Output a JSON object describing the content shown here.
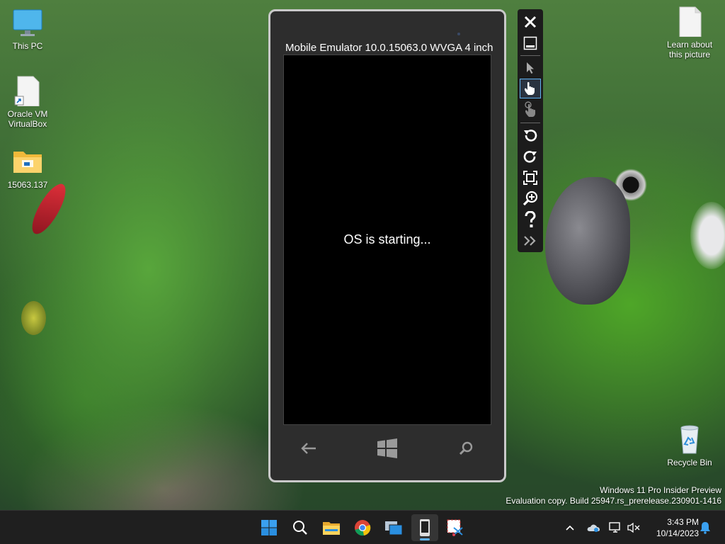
{
  "desktop": {
    "icons": [
      {
        "name": "This PC",
        "icon": "monitor-icon"
      },
      {
        "name": "Oracle VM\nVirtualBox",
        "icon": "shortcut-file-icon"
      },
      {
        "name": "15063.137",
        "icon": "folder-icon"
      },
      {
        "name": "Learn about\nthis picture",
        "icon": "file-icon"
      },
      {
        "name": "Recycle Bin",
        "icon": "recycle-bin-icon"
      }
    ]
  },
  "emulator": {
    "title": "Mobile Emulator 10.0.15063.0 WVGA 4 inch",
    "status": "OS is starting...",
    "nav": [
      "back-icon",
      "windows-start-icon",
      "search-icon"
    ]
  },
  "toolbar": {
    "buttons": [
      "close-icon",
      "minimize-icon",
      "pointer-icon",
      "single-touch-icon",
      "multi-touch-icon",
      "rotate-left-icon",
      "rotate-right-icon",
      "fit-to-screen-icon",
      "zoom-icon",
      "help-icon",
      "expand-tools-icon"
    ]
  },
  "watermark": {
    "line1": "Windows 11 Pro Insider Preview",
    "line2": "Evaluation copy. Build 25947.rs_prerelease.230901-1416"
  },
  "taskbar": {
    "apps": [
      "windows-start-icon",
      "search-icon",
      "file-explorer-icon",
      "chrome-icon",
      "task-view-icon",
      "emulator-app-icon",
      "snipping-tool-icon"
    ],
    "active_app": "emulator-app-icon",
    "tray": [
      "chevron-up-icon",
      "onedrive-icon",
      "network-icon",
      "volume-muted-icon",
      "notification-bell-icon"
    ],
    "time": "3:43 PM",
    "date": "10/14/2023"
  },
  "colors": {
    "accent": "#5fb2f2",
    "emulator_frame": "#2d2d2d",
    "taskbar_bg": "#1f1f1f"
  }
}
